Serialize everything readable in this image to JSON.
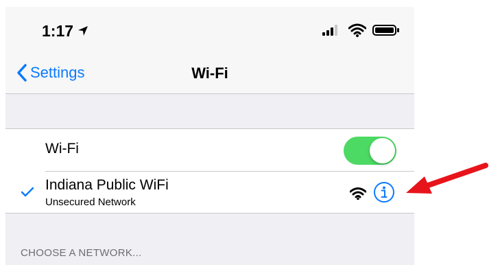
{
  "status_bar": {
    "time": "1:17",
    "icons": [
      "location-arrow-icon",
      "cellular-signal-icon",
      "wifi-icon",
      "battery-icon"
    ]
  },
  "nav": {
    "back_label": "Settings",
    "title": "Wi-Fi"
  },
  "wifi_row": {
    "label": "Wi-Fi",
    "enabled": true
  },
  "connected_network": {
    "name": "Indiana Public WiFi",
    "subtitle": "Unsecured Network",
    "icons": [
      "checkmark-icon",
      "wifi-signal-icon",
      "info-icon"
    ]
  },
  "section_header": "CHOOSE A NETWORK...",
  "annotation": {
    "type": "red-arrow",
    "points_to": "info-button"
  },
  "colors": {
    "accent": "#0a7aff",
    "toggle_on": "#4cd964",
    "arrow": "#e8141b",
    "background": "#efeff4"
  }
}
